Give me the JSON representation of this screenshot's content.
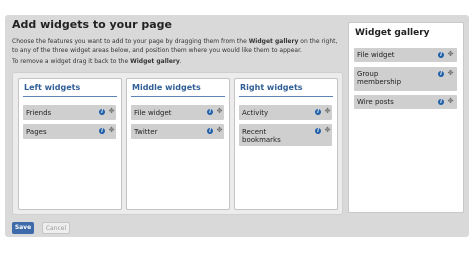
{
  "page": {
    "title": "Add widgets to your page",
    "intro_a": "Choose the features you want to add to your page by dragging them from the ",
    "intro_b": "Widget gallery",
    "intro_c": " on the right, to any of the three widget areas below, and position them where you would like them to appear.",
    "remove_a": "To remove a widget drag it back to the ",
    "remove_b": "Widget gallery",
    "remove_c": "."
  },
  "columns": [
    {
      "heading": "Left widgets",
      "widgets": [
        "Friends",
        "Pages"
      ]
    },
    {
      "heading": "Middle widgets",
      "widgets": [
        "File widget",
        "Twitter"
      ]
    },
    {
      "heading": "Right widgets",
      "widgets": [
        "Activity",
        "Recent bookmarks"
      ]
    }
  ],
  "gallery": {
    "heading": "Widget gallery",
    "widgets": [
      "File widget",
      "Group membership",
      "Wire posts"
    ]
  },
  "buttons": {
    "save": "Save",
    "cancel": "Cancel"
  },
  "icons": {
    "info": "info-icon",
    "move": "move-icon"
  },
  "colors": {
    "accent": "#2f5f96",
    "save": "#3d6aa8",
    "icon": "#1f5fa8"
  }
}
